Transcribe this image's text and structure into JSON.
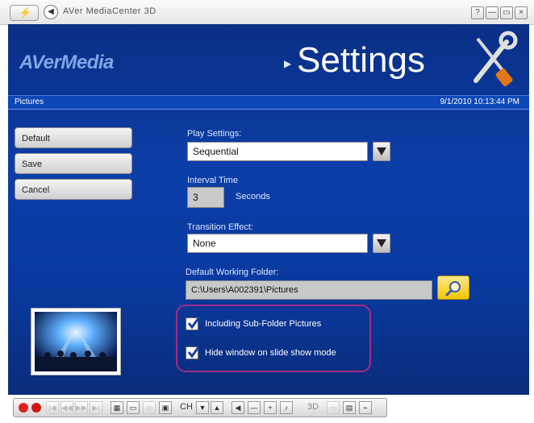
{
  "window": {
    "title": "AVer MediaCenter 3D",
    "buttons": [
      "?",
      "—",
      "▭",
      "×"
    ]
  },
  "brand": {
    "logo": "AVerMedia"
  },
  "page": {
    "title": "Settings",
    "section": "Pictures",
    "datetime": "9/1/2010 10:13:44 PM"
  },
  "sidebar": {
    "buttons": [
      "Default",
      "Save",
      "Cancel"
    ]
  },
  "play_settings": {
    "label": "Play Settings:",
    "value": "Sequential"
  },
  "interval": {
    "label": "Interval Time",
    "value": "3",
    "unit": "Seconds"
  },
  "transition": {
    "label": "Transition Effect:",
    "value": "None"
  },
  "folder": {
    "label": "Default Working Folder:",
    "value": "C:\\Users\\A002391\\Pictures"
  },
  "options": [
    {
      "label": "Including Sub-Folder Pictures",
      "checked": true
    },
    {
      "label": "Hide window on slide show mode",
      "checked": true
    }
  ],
  "controlbar": {
    "channel_label": "CH",
    "mode_label": "3D"
  },
  "colors": {
    "accent_blue": "#0c3ea8",
    "highlight_border": "#a22b8a",
    "folder_button": "#f2c600"
  }
}
